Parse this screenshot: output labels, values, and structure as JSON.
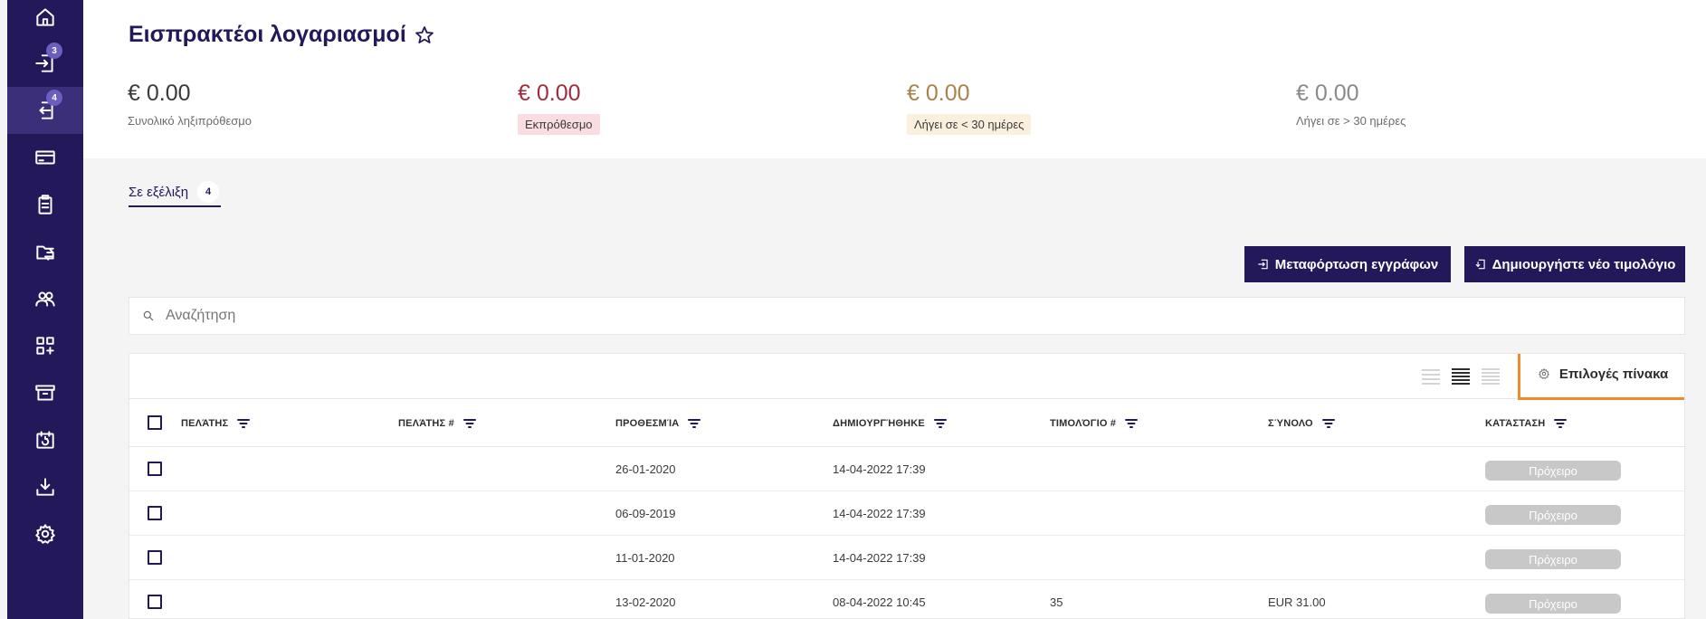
{
  "sidebar": {
    "items": [
      {
        "icon": "home-icon",
        "badge": ""
      },
      {
        "icon": "login-icon",
        "badge": "3"
      },
      {
        "icon": "logout-icon",
        "badge": "4"
      },
      {
        "icon": "credit-card-icon",
        "badge": ""
      },
      {
        "icon": "clipboard-icon",
        "badge": ""
      },
      {
        "icon": "folder-transfer-icon",
        "badge": ""
      },
      {
        "icon": "users-icon",
        "badge": ""
      },
      {
        "icon": "apps-add-icon",
        "badge": ""
      },
      {
        "icon": "archive-icon",
        "badge": ""
      },
      {
        "icon": "calendar-refresh-icon",
        "badge": ""
      },
      {
        "icon": "download-icon",
        "badge": ""
      },
      {
        "icon": "settings-icon",
        "badge": ""
      }
    ]
  },
  "header": {
    "title": "Εισπρακτέοι λογαριασμοί",
    "summaries": [
      {
        "amount": "€ 0.00",
        "label": "Συνολικό ληξιπρόθεσμο",
        "color": "#3a3a3a"
      },
      {
        "amount": "€ 0.00",
        "label": "Εκπρόθεσμο",
        "color": "#a12d3c",
        "chip": "#f9dde1"
      },
      {
        "amount": "€ 0.00",
        "label": "Λήγει σε < 30 ημέρες",
        "color": "#a8834b",
        "chip": "#fbf0dd"
      },
      {
        "amount": "€ 0.00",
        "label": "Λήγει σε > 30 ημέρες",
        "color": "#8a8a8a"
      }
    ]
  },
  "tabs": [
    {
      "label": "Σε εξέλιξη",
      "count": "4"
    }
  ],
  "actions": {
    "upload_label": "Μεταφόρτωση εγγράφων",
    "create_label": "Δημιουργήστε νέο τιμολόγιο"
  },
  "search": {
    "placeholder": "Αναζήτηση"
  },
  "table": {
    "options_label": "Επιλογές πίνακα",
    "columns": [
      "ΠΕΛΆΤΗΣ",
      "ΠΕΛΆΤΗΣ #",
      "ΠΡΟΘΕΣΜΊΑ",
      "ΔΗΜΙΟΥΡΓΉΘΗΚΕ",
      "ΤΙΜΟΛΌΓΙΟ #",
      "ΣΎΝΟΛΟ",
      "ΚΑΤΆΣΤΑΣΗ"
    ],
    "rows": [
      {
        "customer": "",
        "customer_no": "",
        "due": "26-01-2020",
        "created": "14-04-2022 17:39",
        "invoice_no": "",
        "total": "",
        "status": "Πρόχειρο"
      },
      {
        "customer": "",
        "customer_no": "",
        "due": "06-09-2019",
        "created": "14-04-2022 17:39",
        "invoice_no": "",
        "total": "",
        "status": "Πρόχειρο"
      },
      {
        "customer": "",
        "customer_no": "",
        "due": "11-01-2020",
        "created": "14-04-2022 17:39",
        "invoice_no": "",
        "total": "",
        "status": "Πρόχειρο"
      },
      {
        "customer": "",
        "customer_no": "",
        "due": "13-02-2020",
        "created": "08-04-2022 10:45",
        "invoice_no": "35",
        "total": "EUR 31.00",
        "status": "Πρόχειρο"
      }
    ]
  }
}
